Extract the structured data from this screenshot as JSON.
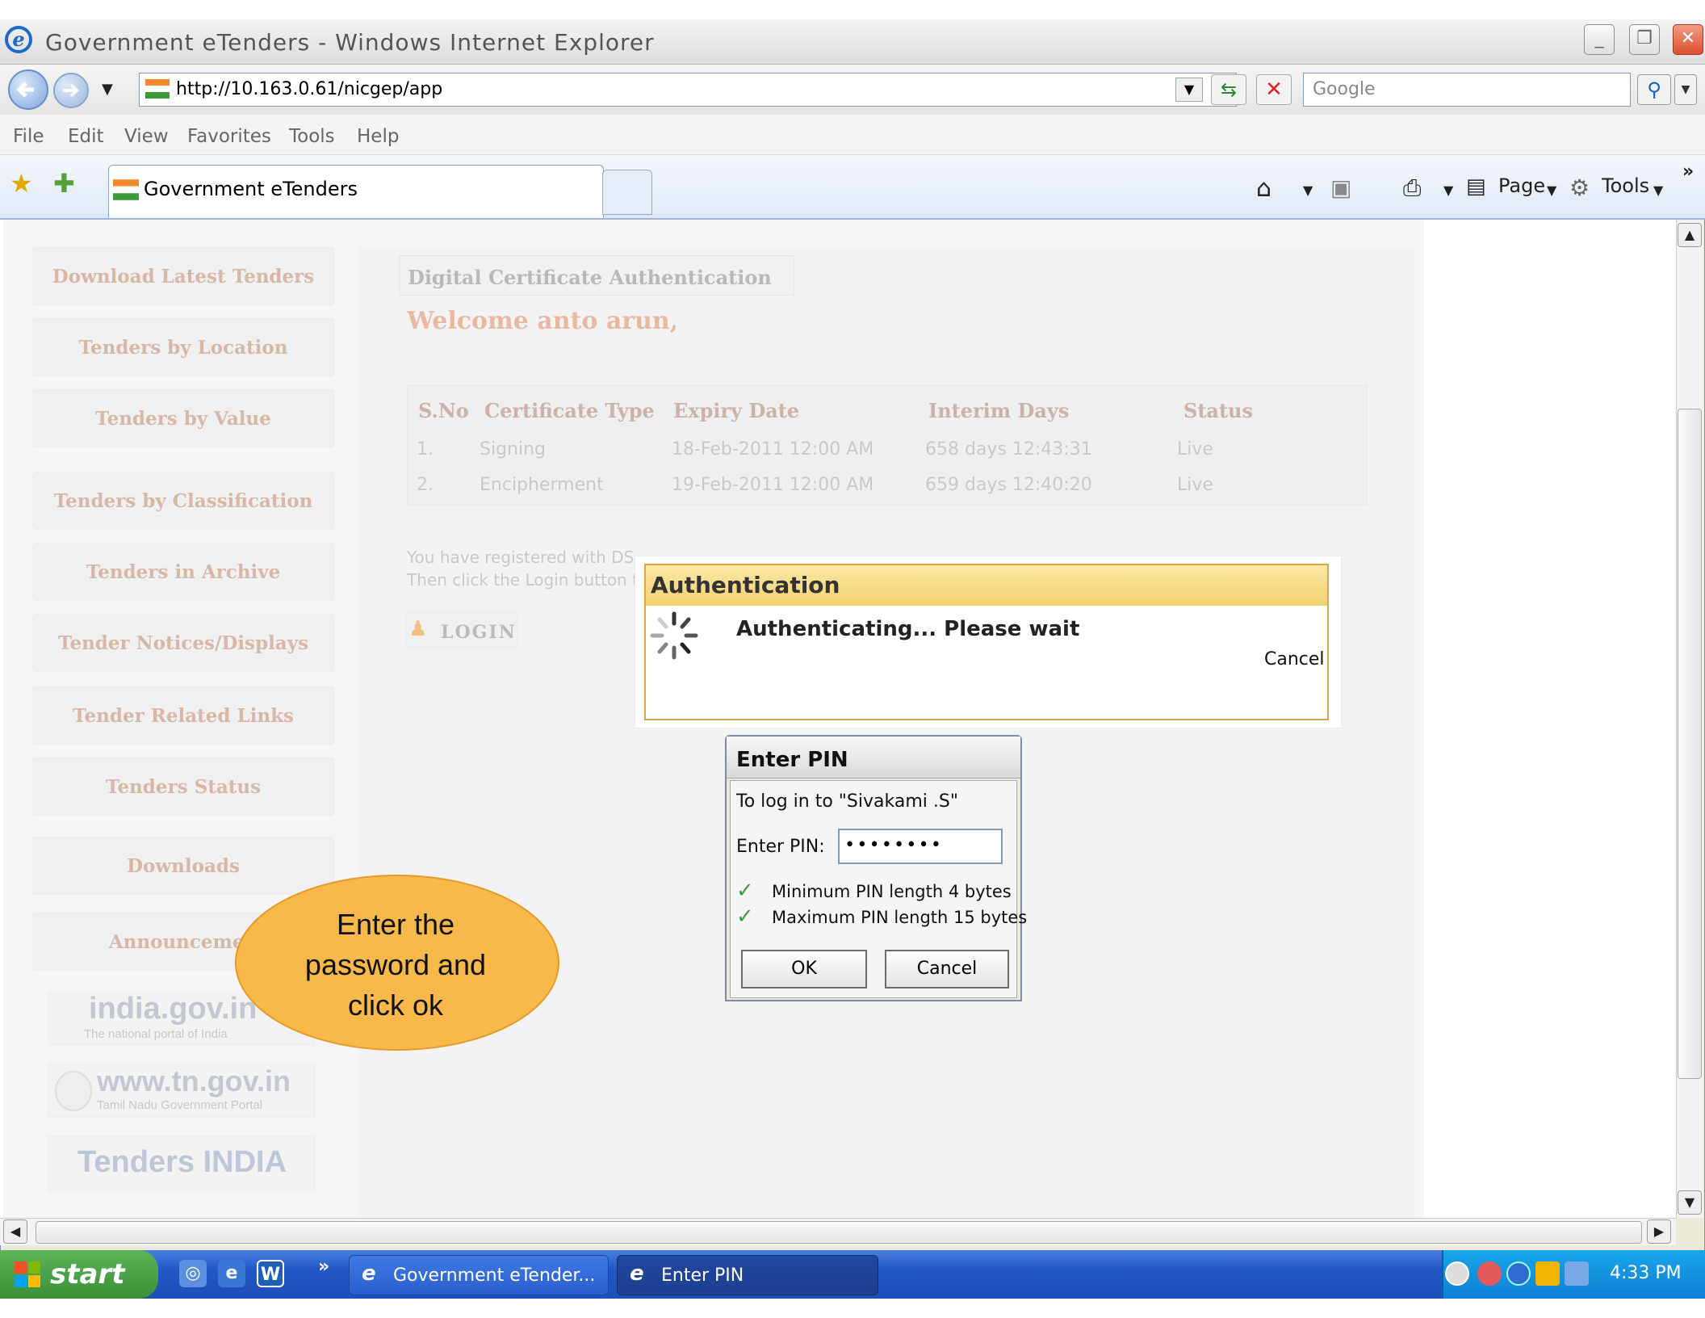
{
  "window": {
    "title": "Government eTenders - Windows Internet Explorer",
    "minimize": "_",
    "restore": "❐",
    "close": "✕"
  },
  "address": {
    "url": "http://10.163.0.61/nicgep/app",
    "search_placeholder": "Google"
  },
  "menu": [
    "File",
    "Edit",
    "View",
    "Favorites",
    "Tools",
    "Help"
  ],
  "tab": {
    "label": "Government eTenders"
  },
  "command_bar": {
    "page": "Page",
    "tools": "Tools"
  },
  "sidebar": {
    "items": [
      {
        "label": "Download Latest Tenders"
      },
      {
        "label": "Tenders by Location"
      },
      {
        "label": "Tenders by Value"
      },
      {
        "label": "Tenders by Classification"
      },
      {
        "label": "Tenders in Archive"
      },
      {
        "label": "Tender Notices/Displays"
      },
      {
        "label": "Tender Related Links"
      },
      {
        "label": "Tenders Status"
      },
      {
        "label": "Downloads"
      },
      {
        "label": "Announcemen"
      }
    ],
    "logos": {
      "india": "india.gov.in",
      "india_sub": "The national portal of India",
      "tn": "www.tn.gov.in",
      "tn_sub": "Tamil Nadu Government Portal",
      "tenders": "Tenders INDIA"
    }
  },
  "main": {
    "section_title": "Digital Certificate Authentication",
    "welcome": "Welcome anto arun,",
    "table": {
      "headers": [
        "S.No",
        "Certificate Type",
        "Expiry Date",
        "Interim Days",
        "Status"
      ],
      "rows": [
        [
          "1.",
          "Signing",
          "18-Feb-2011 12:00 AM",
          "658 days 12:43:31",
          "Live"
        ],
        [
          "2.",
          "Encipherment",
          "19-Feb-2011 12:00 AM",
          "659 days 12:40:20",
          "Live"
        ]
      ]
    },
    "registered_text_1": "You have registered with DS",
    "registered_text_2": "Then click the Login button t",
    "login_label": "LOGIN"
  },
  "auth_dialog": {
    "title": "Authentication",
    "message": "Authenticating... Please wait",
    "cancel": "Cancel"
  },
  "pin_dialog": {
    "title": "Enter PIN",
    "login_to": "To log in to \"Sivakami .S\"",
    "pin_label": "Enter PIN:",
    "pin_value": "••••••••",
    "rule_min": "Minimum PIN length 4 bytes",
    "rule_max": "Maximum PIN length 15 bytes",
    "ok": "OK",
    "cancel": "Cancel"
  },
  "callout": {
    "line1": "Enter the",
    "line2": "password and",
    "line3": "click ok",
    "fill": "#f8b94a"
  },
  "taskbar": {
    "start": "start",
    "tasks": [
      {
        "label": "Government eTender..."
      },
      {
        "label": "Enter PIN"
      }
    ],
    "clock": "4:33 PM",
    "more": "»"
  }
}
